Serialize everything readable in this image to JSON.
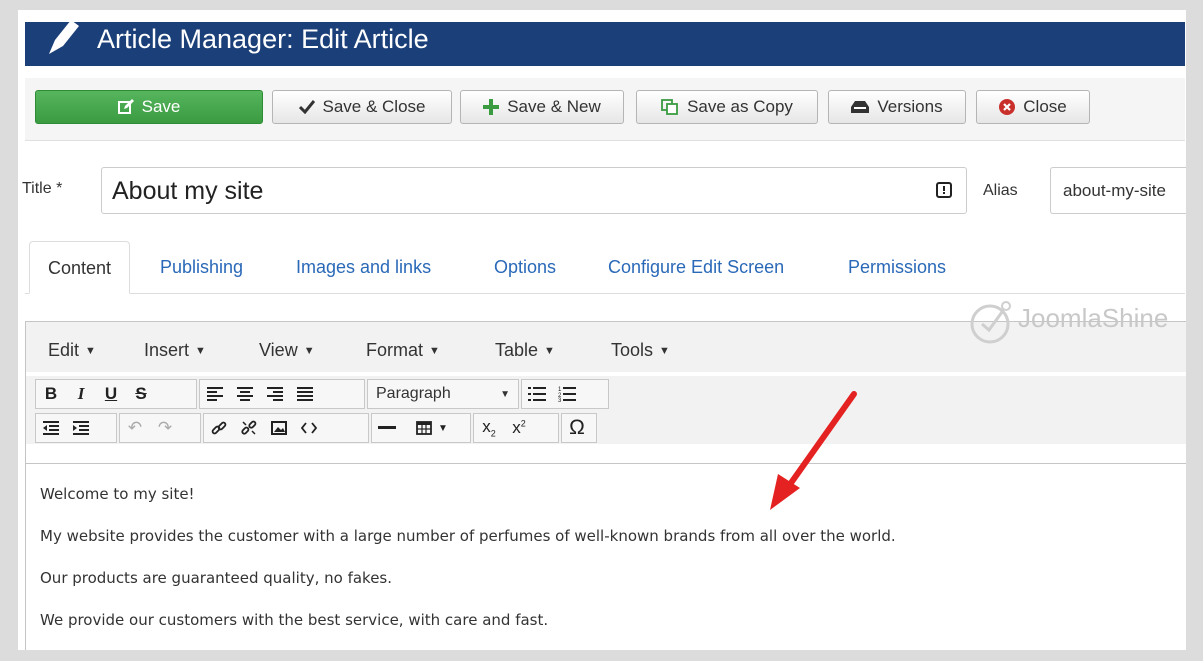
{
  "header": {
    "title": "Article Manager: Edit Article"
  },
  "toolbar": {
    "save_label": "Save",
    "save_close_label": "Save & Close",
    "save_new_label": "Save & New",
    "save_copy_label": "Save as Copy",
    "versions_label": "Versions",
    "close_label": "Close"
  },
  "form": {
    "title_label": "Title *",
    "title_value": "About my site",
    "alias_label": "Alias",
    "alias_value": "about-my-site"
  },
  "tabs": [
    {
      "label": "Content",
      "active": true
    },
    {
      "label": "Publishing"
    },
    {
      "label": "Images and links"
    },
    {
      "label": "Options"
    },
    {
      "label": "Configure Edit Screen"
    },
    {
      "label": "Permissions"
    }
  ],
  "editor": {
    "menu": [
      "Edit",
      "Insert",
      "View",
      "Format",
      "Table",
      "Tools"
    ],
    "format_select": "Paragraph",
    "paragraphs": [
      "Welcome to my site!",
      "My website provides the customer with a large number of perfumes of well-known brands from all over the world.",
      "Our products are guaranteed quality, no fakes.",
      "We provide our customers with the best service, with care and fast."
    ]
  },
  "watermark": {
    "text": "JoomlaShine"
  },
  "colors": {
    "header_bg": "#1b3f78",
    "save_green": "#3a9b41",
    "link_blue": "#2a69b8",
    "arrow_red": "#e52222"
  }
}
